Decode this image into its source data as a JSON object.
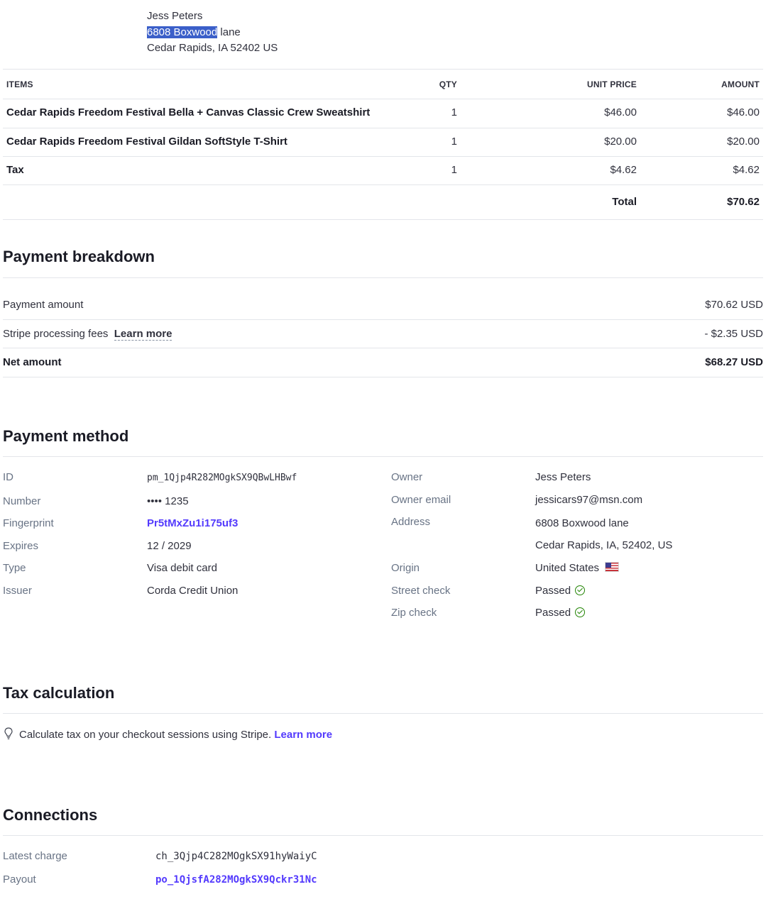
{
  "shipping": {
    "name": "Jess Peters",
    "street_highlighted": "6808 Boxwood",
    "street_rest": " lane",
    "city_line": "Cedar Rapids, IA 52402 US"
  },
  "items_table": {
    "headers": {
      "items": "ITEMS",
      "qty": "QTY",
      "unit_price": "UNIT PRICE",
      "amount": "AMOUNT"
    },
    "rows": [
      {
        "name": "Cedar Rapids Freedom Festival Bella + Canvas Classic Crew Sweatshirt",
        "qty": "1",
        "unit_price": "$46.00",
        "amount": "$46.00"
      },
      {
        "name": "Cedar Rapids Freedom Festival Gildan SoftStyle T-Shirt",
        "qty": "1",
        "unit_price": "$20.00",
        "amount": "$20.00"
      },
      {
        "name": "Tax",
        "qty": "1",
        "unit_price": "$4.62",
        "amount": "$4.62"
      }
    ],
    "total_label": "Total",
    "total_value": "$70.62"
  },
  "payment_breakdown": {
    "title": "Payment breakdown",
    "payment_amount_label": "Payment amount",
    "payment_amount_value": "$70.62 USD",
    "fees_label": "Stripe processing fees",
    "fees_learn_more": "Learn more",
    "fees_value": "- $2.35 USD",
    "net_label": "Net amount",
    "net_value": "$68.27 USD"
  },
  "payment_method": {
    "title": "Payment method",
    "left": [
      {
        "label": "ID",
        "value": "pm_1Qjp4R282MOgkSX9QBwLHBwf"
      },
      {
        "label": "Number",
        "value": "•••• 1235"
      },
      {
        "label": "Fingerprint",
        "value": "Pr5tMxZu1i175uf3"
      },
      {
        "label": "Expires",
        "value": "12 / 2029"
      },
      {
        "label": "Type",
        "value": "Visa debit card"
      },
      {
        "label": "Issuer",
        "value": "Corda Credit Union"
      }
    ],
    "right": {
      "owner_label": "Owner",
      "owner_value": "Jess Peters",
      "email_label": "Owner email",
      "email_value": "jessicars97@msn.com",
      "address_label": "Address",
      "address_line1": "6808 Boxwood lane",
      "address_line2": "Cedar Rapids, IA, 52402, US",
      "origin_label": "Origin",
      "origin_value": "United States",
      "street_check_label": "Street check",
      "street_check_value": "Passed",
      "zip_check_label": "Zip check",
      "zip_check_value": "Passed"
    }
  },
  "tax_calculation": {
    "title": "Tax calculation",
    "text": "Calculate tax on your checkout sessions using Stripe.",
    "link": "Learn more"
  },
  "connections": {
    "title": "Connections",
    "latest_charge_label": "Latest charge",
    "latest_charge_value": "ch_3Qjp4C282MOgkSX91hyWaiyC",
    "payout_label": "Payout",
    "payout_value": "po_1QjsfA282MOgkSX9Qckr31Nc"
  },
  "icons": {
    "bulb": "lightbulb-icon",
    "check": "check-circle-icon",
    "flag": "us-flag-icon"
  },
  "colors": {
    "link": "#533afd",
    "success": "#228403",
    "highlight": "#3b5fc9"
  }
}
